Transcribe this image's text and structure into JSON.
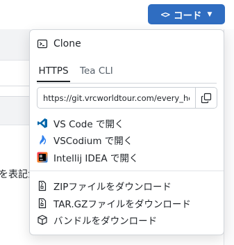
{
  "header_button": {
    "label": "コード",
    "icon": "code-brackets-icon"
  },
  "background": {
    "fragment_text": "を表記が"
  },
  "dropdown": {
    "title": "Clone",
    "tabs": [
      {
        "label": "HTTPS",
        "active": true
      },
      {
        "label": "Tea CLI",
        "active": false
      }
    ],
    "clone_url": "https://git.vrcworldtour.com/every_holi",
    "open_in": [
      {
        "label": "VS Code で開く",
        "icon": "vscode-icon"
      },
      {
        "label": "VSCodium で開く",
        "icon": "vscodium-icon"
      },
      {
        "label": "Intellij IDEA で開く",
        "icon": "intellij-idea-icon"
      }
    ],
    "downloads": [
      {
        "label": "ZIPファイルをダウンロード",
        "icon": "file-zip-icon"
      },
      {
        "label": "TAR.GZファイルをダウンロード",
        "icon": "file-zip-icon"
      },
      {
        "label": "バンドルをダウンロード",
        "icon": "package-icon"
      }
    ]
  },
  "colors": {
    "primary_button": "#2f6dc1",
    "vscode": "#0065a9",
    "vscodium": "#2f80ed",
    "intellij": "#fe2857"
  }
}
